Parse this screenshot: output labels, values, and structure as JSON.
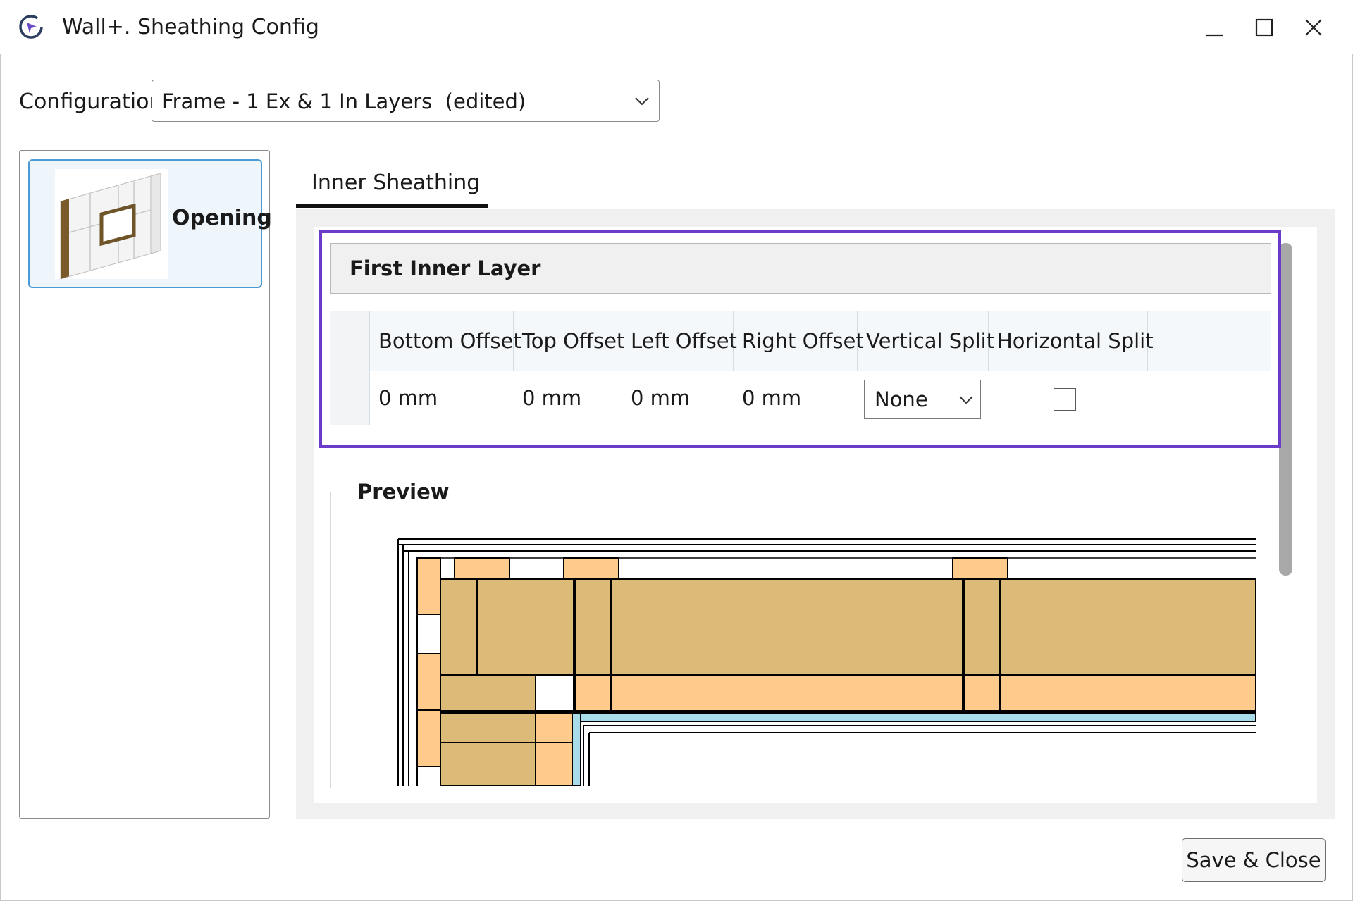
{
  "window": {
    "title": "Wall+. Sheathing Config",
    "app_icon": "wallplus-logo-icon",
    "controls": [
      "minimize-icon",
      "maximize-icon",
      "close-icon"
    ]
  },
  "configuration": {
    "label": "Configuration",
    "selected": "Frame - 1 Ex & 1 In Layers  (edited)"
  },
  "sidebar": {
    "items": [
      {
        "label": "Opening",
        "icon": "wall-opening-thumbnail",
        "selected": true
      }
    ]
  },
  "tabs": [
    {
      "label": "Inner Sheathing",
      "active": true
    }
  ],
  "layer": {
    "title": "First Inner Layer",
    "columns": [
      "Bottom Offset",
      "Top Offset",
      "Left Offset",
      "Right Offset",
      "Vertical Split",
      "Horizontal Split"
    ],
    "row": {
      "bottom_offset": "0 mm",
      "top_offset": "0 mm",
      "left_offset": "0 mm",
      "right_offset": "0 mm",
      "vertical_split": "None",
      "horizontal_split": false
    }
  },
  "preview": {
    "label": "Preview",
    "colors": {
      "framing": "#dcba78",
      "sheathing": "#fecb8c",
      "membrane": "#a8dce8",
      "outline": "#000000"
    }
  },
  "footer": {
    "save_label": "Save & Close"
  },
  "colors": {
    "highlight": "#6a3cc8",
    "selection_border": "#4a9ad6",
    "selection_bg": "#eef6fc"
  }
}
